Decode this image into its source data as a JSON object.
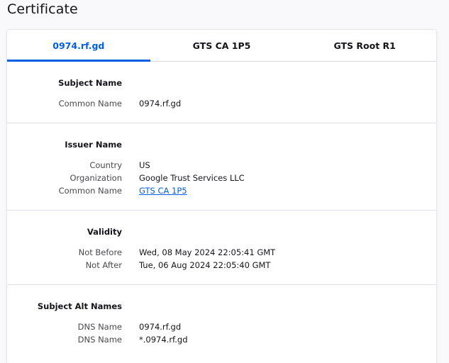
{
  "page": {
    "title": "Certificate"
  },
  "tabs": [
    {
      "label": "0974.rf.gd",
      "active": true
    },
    {
      "label": "GTS CA 1P5",
      "active": false
    },
    {
      "label": "GTS Root R1",
      "active": false
    }
  ],
  "sections": {
    "subject_name": {
      "title": "Subject Name",
      "rows": [
        {
          "label": "Common Name",
          "value": "0974.rf.gd"
        }
      ]
    },
    "issuer_name": {
      "title": "Issuer Name",
      "rows": [
        {
          "label": "Country",
          "value": "US"
        },
        {
          "label": "Organization",
          "value": "Google Trust Services LLC"
        },
        {
          "label": "Common Name",
          "value": "GTS CA 1P5"
        }
      ]
    },
    "validity": {
      "title": "Validity",
      "rows": [
        {
          "label": "Not Before",
          "value": "Wed, 08 May 2024 22:05:41 GMT"
        },
        {
          "label": "Not After",
          "value": "Tue, 06 Aug 2024 22:05:40 GMT"
        }
      ]
    },
    "subject_alt_names": {
      "title": "Subject Alt Names",
      "rows": [
        {
          "label": "DNS Name",
          "value": "0974.rf.gd"
        },
        {
          "label": "DNS Name",
          "value": "*.0974.rf.gd"
        }
      ]
    }
  },
  "colors": {
    "accent": "#0061e0",
    "text": "#15141a",
    "label": "#4a4a4f",
    "divider": "#e0e0e6"
  }
}
